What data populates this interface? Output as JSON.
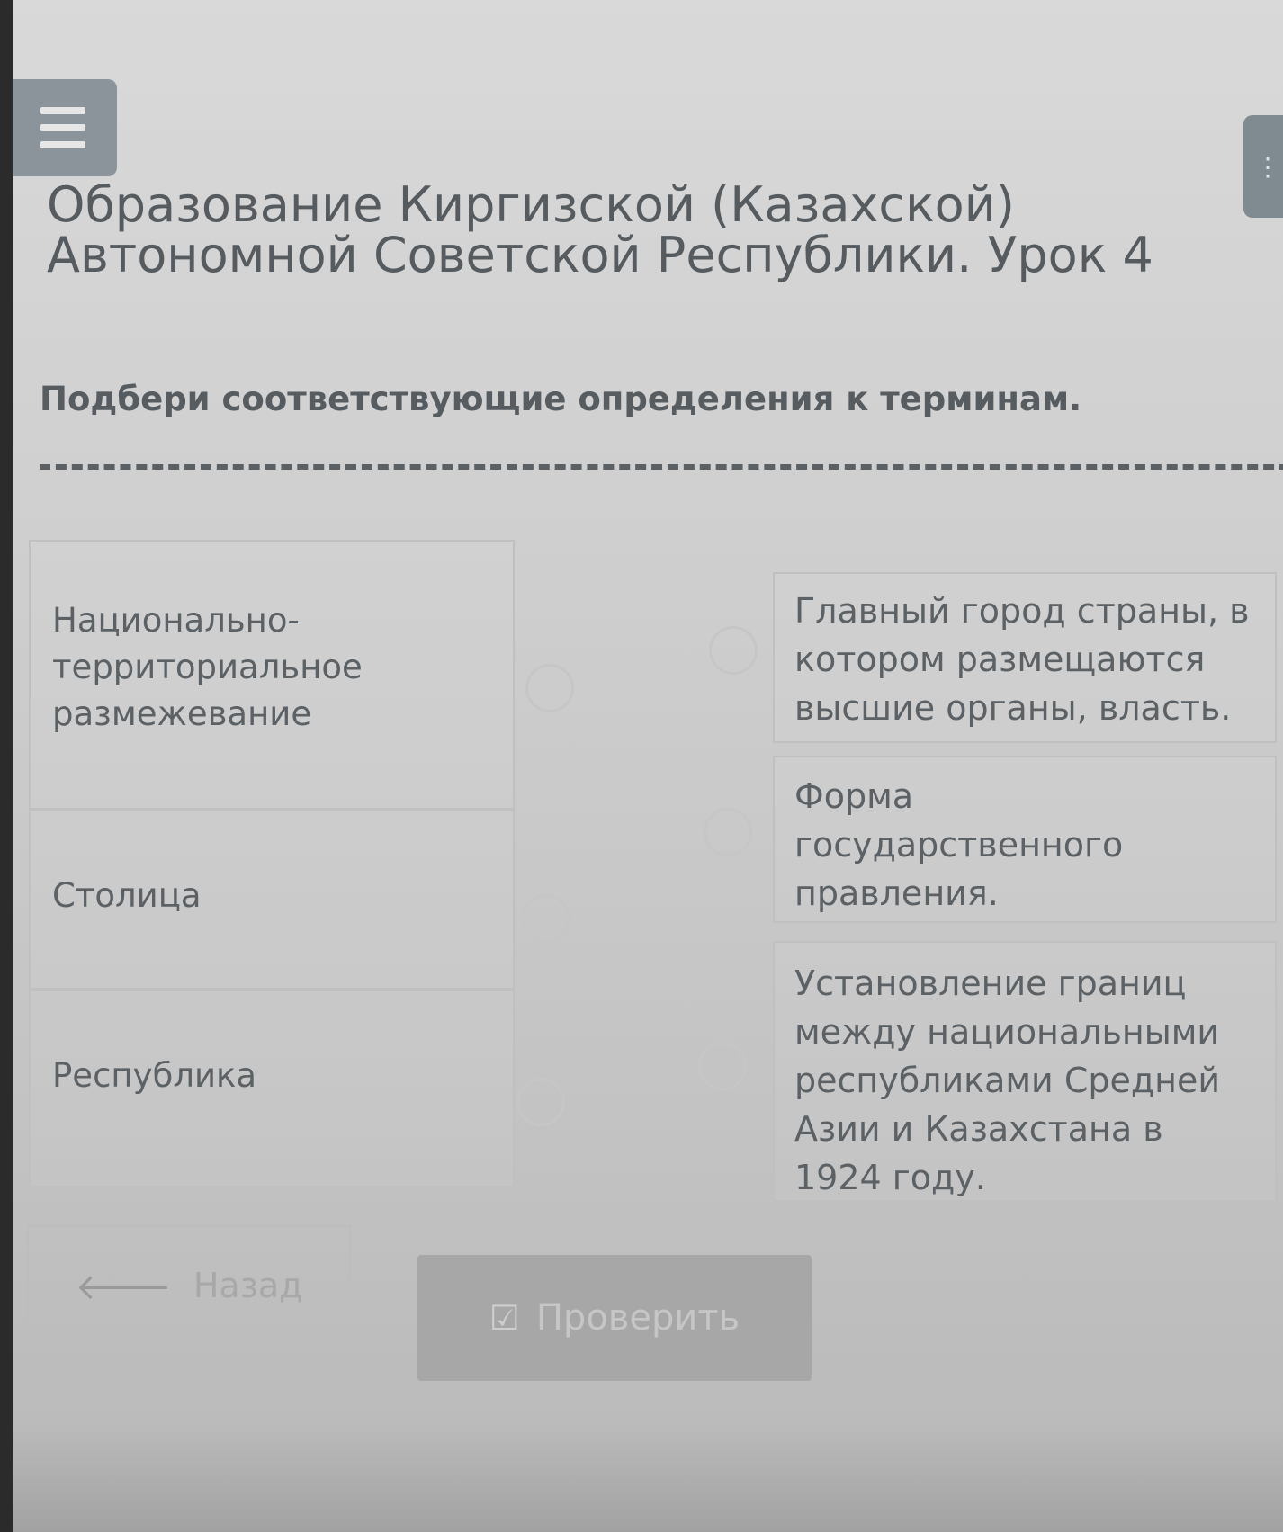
{
  "header": {
    "title": "Образование Киргизской (Казахской) Автономной Советской Республики. Урок 4"
  },
  "task": {
    "instruction": "Подбери соответствующие определения к терминам."
  },
  "terms": [
    {
      "label": "Национально-территориальное размежевание"
    },
    {
      "label": "Столица"
    },
    {
      "label": "Республика"
    }
  ],
  "definitions": [
    {
      "label": "Главный город страны, в котором размещаются высшие органы, власть."
    },
    {
      "label": "Форма государственного правления."
    },
    {
      "label": "Установление границ между национальными республиками Средней Азии и Казахстана в 1924 году."
    }
  ],
  "footer": {
    "back_label": "Назад",
    "check_label": "Проверить"
  },
  "icons": {
    "menu": "hamburger-icon",
    "back": "arrow-left-icon",
    "check": "checkbox-check-icon"
  }
}
